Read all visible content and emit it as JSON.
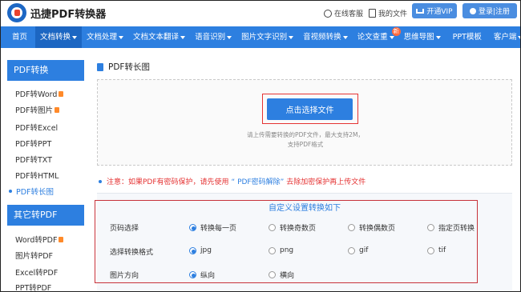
{
  "header": {
    "brand": "迅捷PDF转换器",
    "support_label": "在线客服",
    "files_label": "我的文件",
    "vip_label": "开通VIP",
    "login_label": "登录|注册"
  },
  "nav": {
    "items": [
      {
        "label": "首页"
      },
      {
        "label": "文档转换"
      },
      {
        "label": "文档处理"
      },
      {
        "label": "文档文本翻译"
      },
      {
        "label": "语音识别"
      },
      {
        "label": "图片文字识别"
      },
      {
        "label": "音视频转换"
      },
      {
        "label": "论文查重"
      },
      {
        "label": "思维导图"
      },
      {
        "label": "PPT模板"
      },
      {
        "label": "客户端"
      }
    ],
    "new_badge": "新"
  },
  "sidebar": {
    "group1_title": "PDF转换",
    "group1_items": [
      {
        "label": "PDF转Word"
      },
      {
        "label": "PDF转图片"
      },
      {
        "label": "PDF转Excel"
      },
      {
        "label": "PDF转PPT"
      },
      {
        "label": "PDF转TXT"
      },
      {
        "label": "PDF转HTML"
      },
      {
        "label": "PDF转长图"
      }
    ],
    "group2_title": "其它转PDF",
    "group2_items": [
      {
        "label": "Word转PDF"
      },
      {
        "label": "图片转PDF"
      },
      {
        "label": "Excel转PDF"
      },
      {
        "label": "PPT转PDF"
      }
    ]
  },
  "main": {
    "section_title": "PDF转长图",
    "upload_button": "点击选择文件",
    "upload_hint_1": "请上传需要转换的PDF文件，最大支持2M，",
    "upload_hint_2": "支持PDF格式",
    "notice_prefix": "注意：如果PDF有密码保护，请先使用",
    "notice_link": "“ PDF密码解除”",
    "notice_suffix": "去除加密保护再上传文件",
    "settings_title": "自定义设置转换如下",
    "rows": [
      {
        "label": "页码选择",
        "options": [
          "转换每一页",
          "转换奇数页",
          "转换偶数页",
          "指定页转换"
        ],
        "selected": 0
      },
      {
        "label": "选择转换格式",
        "options": [
          "jpg",
          "png",
          "gif",
          "tif"
        ],
        "selected": 0
      },
      {
        "label": "图片方向",
        "options": [
          "纵向",
          "横向"
        ],
        "selected": 0
      }
    ]
  },
  "colors": {
    "accent": "#2d7fe0",
    "highlight": "#e53333"
  }
}
